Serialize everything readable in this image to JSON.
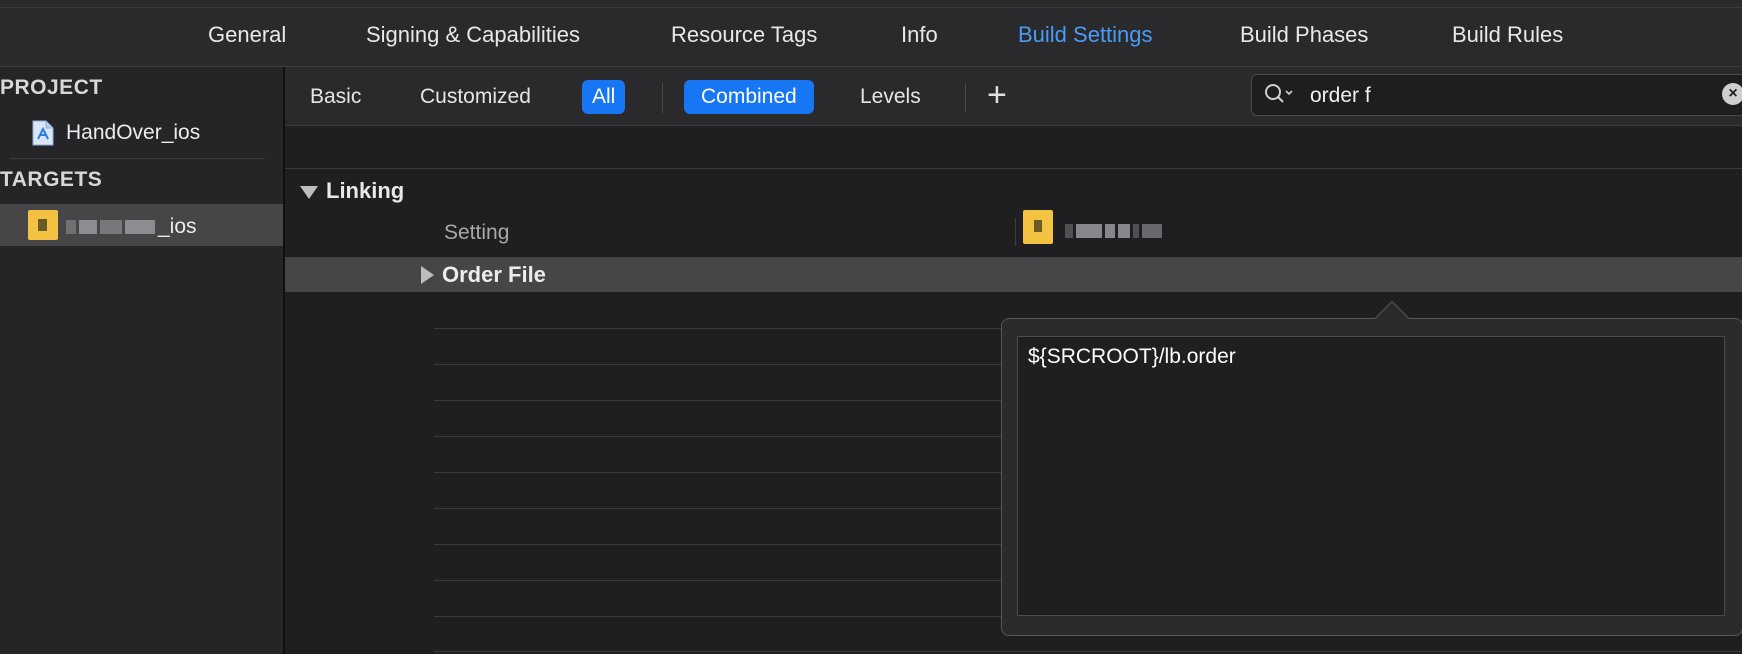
{
  "tabs": [
    {
      "label": "General"
    },
    {
      "label": "Signing & Capabilities"
    },
    {
      "label": "Resource Tags"
    },
    {
      "label": "Info"
    },
    {
      "label": "Build Settings",
      "active": true
    },
    {
      "label": "Build Phases"
    },
    {
      "label": "Build Rules"
    }
  ],
  "sidebar": {
    "project_header": "PROJECT",
    "project_item": "HandOver_ios",
    "targets_header": "TARGETS",
    "target_item_suffix": "_ios"
  },
  "filter": {
    "basic": "Basic",
    "customized": "Customized",
    "all": "All",
    "combined": "Combined",
    "levels": "Levels",
    "add": "+"
  },
  "search": {
    "value": "order f",
    "clear": "×"
  },
  "settings": {
    "section": "Linking",
    "column_setting": "Setting",
    "row_label": "Order File"
  },
  "editor": {
    "value": "${SRCROOT}/lb.order"
  },
  "colors": {
    "accent": "#1676f3",
    "active_tab": "#4a9bf5",
    "target_icon": "#f3c243"
  },
  "icons": [
    "search-icon",
    "chevron-down-icon",
    "clear-icon",
    "file-icon",
    "target-icon",
    "disclosure-triangle-icon",
    "plus-icon"
  ]
}
